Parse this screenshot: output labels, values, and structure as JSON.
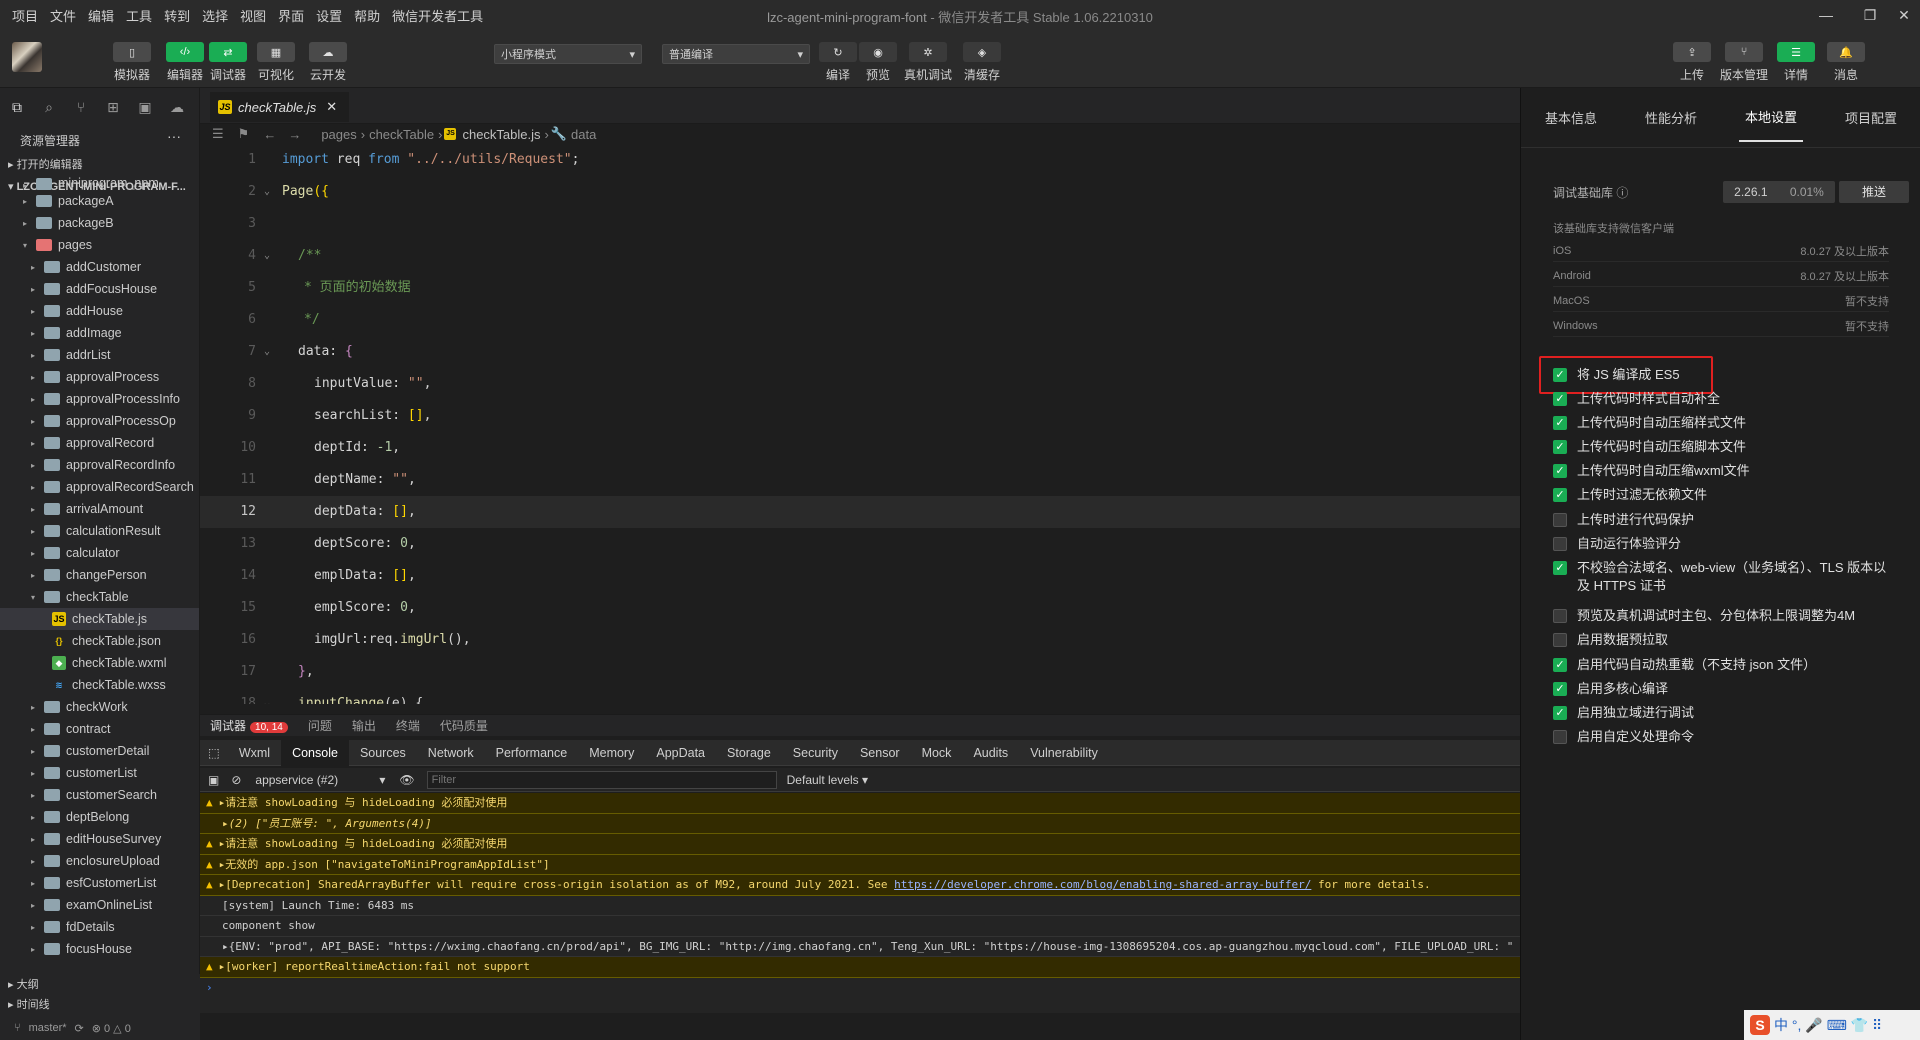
{
  "menu": [
    "项目",
    "文件",
    "编辑",
    "工具",
    "转到",
    "选择",
    "视图",
    "界面",
    "设置",
    "帮助",
    "微信开发者工具"
  ],
  "window_title": {
    "main": "lzc-agent-mini-program-font",
    "sub": "- 微信开发者工具 Stable 1.06.2210310"
  },
  "toolbar": {
    "left_buttons": [
      "模拟器",
      "编辑器",
      "调试器",
      "可视化",
      "云开发"
    ],
    "mode_select": "小程序模式",
    "compile_select": "普通编译",
    "mid_buttons": [
      "编译",
      "预览",
      "真机调试",
      "清缓存"
    ],
    "right_buttons": [
      "上传",
      "版本管理",
      "详情",
      "消息"
    ]
  },
  "explorer": {
    "title": "资源管理器",
    "more": "···",
    "open_editors": "打开的编辑器",
    "project": "LZC-AGENT-MINI-PROGRAM-F...",
    "tree": [
      {
        "label": "miniprogram_npm",
        "type": "folder",
        "depth": 1,
        "arrow": "▸"
      },
      {
        "label": "packageA",
        "type": "folder",
        "depth": 1,
        "arrow": "▸"
      },
      {
        "label": "packageB",
        "type": "folder",
        "depth": 1,
        "arrow": "▸"
      },
      {
        "label": "pages",
        "type": "folder-red",
        "depth": 1,
        "arrow": "▾"
      },
      {
        "label": "addCustomer",
        "type": "folder",
        "depth": 2,
        "arrow": "▸"
      },
      {
        "label": "addFocusHouse",
        "type": "folder",
        "depth": 2,
        "arrow": "▸"
      },
      {
        "label": "addHouse",
        "type": "folder",
        "depth": 2,
        "arrow": "▸"
      },
      {
        "label": "addImage",
        "type": "folder",
        "depth": 2,
        "arrow": "▸"
      },
      {
        "label": "addrList",
        "type": "folder",
        "depth": 2,
        "arrow": "▸"
      },
      {
        "label": "approvalProcess",
        "type": "folder",
        "depth": 2,
        "arrow": "▸"
      },
      {
        "label": "approvalProcessInfo",
        "type": "folder",
        "depth": 2,
        "arrow": "▸"
      },
      {
        "label": "approvalProcessOp",
        "type": "folder",
        "depth": 2,
        "arrow": "▸"
      },
      {
        "label": "approvalRecord",
        "type": "folder",
        "depth": 2,
        "arrow": "▸"
      },
      {
        "label": "approvalRecordInfo",
        "type": "folder",
        "depth": 2,
        "arrow": "▸"
      },
      {
        "label": "approvalRecordSearch",
        "type": "folder",
        "depth": 2,
        "arrow": "▸"
      },
      {
        "label": "arrivalAmount",
        "type": "folder",
        "depth": 2,
        "arrow": "▸"
      },
      {
        "label": "calculationResult",
        "type": "folder",
        "depth": 2,
        "arrow": "▸"
      },
      {
        "label": "calculator",
        "type": "folder",
        "depth": 2,
        "arrow": "▸"
      },
      {
        "label": "changePerson",
        "type": "folder",
        "depth": 2,
        "arrow": "▸"
      },
      {
        "label": "checkTable",
        "type": "folder",
        "depth": 2,
        "arrow": "▾"
      },
      {
        "label": "checkTable.js",
        "type": "js",
        "depth": 3,
        "arrow": ""
      },
      {
        "label": "checkTable.json",
        "type": "json",
        "depth": 3,
        "arrow": ""
      },
      {
        "label": "checkTable.wxml",
        "type": "wxml",
        "depth": 3,
        "arrow": ""
      },
      {
        "label": "checkTable.wxss",
        "type": "wxss",
        "depth": 3,
        "arrow": ""
      },
      {
        "label": "checkWork",
        "type": "folder",
        "depth": 2,
        "arrow": "▸"
      },
      {
        "label": "contract",
        "type": "folder",
        "depth": 2,
        "arrow": "▸"
      },
      {
        "label": "customerDetail",
        "type": "folder",
        "depth": 2,
        "arrow": "▸"
      },
      {
        "label": "customerList",
        "type": "folder",
        "depth": 2,
        "arrow": "▸"
      },
      {
        "label": "customerSearch",
        "type": "folder",
        "depth": 2,
        "arrow": "▸"
      },
      {
        "label": "deptBelong",
        "type": "folder",
        "depth": 2,
        "arrow": "▸"
      },
      {
        "label": "editHouseSurvey",
        "type": "folder",
        "depth": 2,
        "arrow": "▸"
      },
      {
        "label": "enclosureUpload",
        "type": "folder",
        "depth": 2,
        "arrow": "▸"
      },
      {
        "label": "esfCustomerList",
        "type": "folder",
        "depth": 2,
        "arrow": "▸"
      },
      {
        "label": "examOnlineList",
        "type": "folder",
        "depth": 2,
        "arrow": "▸"
      },
      {
        "label": "fdDetails",
        "type": "folder",
        "depth": 2,
        "arrow": "▸"
      },
      {
        "label": "focusHouse",
        "type": "folder",
        "depth": 2,
        "arrow": "▸"
      }
    ],
    "outline": "大纲",
    "timeline": "时间线",
    "branch": "master*",
    "problems": "⊗ 0 △ 0"
  },
  "editor": {
    "tab": "checkTable.js",
    "breadcrumb": [
      "pages",
      "checkTable",
      "checkTable.js",
      "data"
    ],
    "current_line": 12
  },
  "console": {
    "tabs": [
      "调试器",
      "问题",
      "输出",
      "终端",
      "代码质量"
    ],
    "badge": "10, 14",
    "devtools_tabs": [
      "Wxml",
      "Console",
      "Sources",
      "Network",
      "Performance",
      "Memory",
      "AppData",
      "Storage",
      "Security",
      "Sensor",
      "Mock",
      "Audits",
      "Vulnerability"
    ],
    "context": "appservice (#2)",
    "filter_placeholder": "Filter",
    "levels": "Default levels",
    "lines": [
      {
        "kind": "warn",
        "text": "▸请注意 showLoading 与 hideLoading 必须配对使用"
      },
      {
        "kind": "warn-sub",
        "text": "▸(2) [\"员工账号: \", Arguments(4)]"
      },
      {
        "kind": "warn",
        "text": "▸请注意 showLoading 与 hideLoading 必须配对使用"
      },
      {
        "kind": "warn",
        "text": "▸无效的 app.json [\"navigateToMiniProgramAppIdList\"]"
      },
      {
        "kind": "warn",
        "text": "▸[Deprecation] SharedArrayBuffer will require cross-origin isolation as of M92, around July 2021. See ",
        "link": "https://developer.chrome.com/blog/enabling-shared-array-buffer/",
        "tail": " for more details."
      },
      {
        "kind": "log",
        "text": "[system] Launch Time: 6483 ms"
      },
      {
        "kind": "log",
        "text": "component show"
      },
      {
        "kind": "log",
        "text": "▸{ENV: \"prod\", API_BASE: \"https://wximg.chaofang.cn/prod/api\", BG_IMG_URL: \"http://img.chaofang.cn\", Teng_Xun_URL: \"https://house-img-1308695204.cos.ap-guangzhou.myqcloud.com\", FILE_UPLOAD_URL: \""
      },
      {
        "kind": "warn",
        "text": "▸[worker] reportRealtimeAction:fail not support"
      },
      {
        "kind": "prompt",
        "text": "›"
      }
    ]
  },
  "right_panel": {
    "tabs": [
      "基本信息",
      "性能分析",
      "本地设置",
      "项目配置"
    ],
    "lib_label": "调试基础库 ⓘ",
    "lib_version": "2.26.1",
    "lib_percent": "0.01%",
    "push": "推送",
    "support_title": "该基础库支持微信客户端",
    "support": [
      {
        "os": "iOS",
        "value": "8.0.27 及以上版本"
      },
      {
        "os": "Android",
        "value": "8.0.27 及以上版本"
      },
      {
        "os": "MacOS",
        "value": "暂不支持"
      },
      {
        "os": "Windows",
        "value": "暂不支持"
      }
    ],
    "settings": [
      {
        "label": "将 JS 编译成 ES5",
        "checked": true
      },
      {
        "label": "上传代码时样式自动补全",
        "checked": true
      },
      {
        "label": "上传代码时自动压缩样式文件",
        "checked": true
      },
      {
        "label": "上传代码时自动压缩脚本文件",
        "checked": true
      },
      {
        "label": "上传代码时自动压缩wxml文件",
        "checked": true
      },
      {
        "label": "上传时过滤无依赖文件",
        "checked": true
      },
      {
        "label": "上传时进行代码保护",
        "checked": false
      },
      {
        "label": "自动运行体验评分",
        "checked": false
      },
      {
        "label": "不校验合法域名、web-view（业务域名）、TLS 版本以及 HTTPS 证书",
        "checked": true
      },
      {
        "label": "预览及真机调试时主包、分包体积上限调整为4M",
        "checked": false
      },
      {
        "label": "启用数据预拉取",
        "checked": false
      },
      {
        "label": "启用代码自动热重载（不支持 json 文件）",
        "checked": true
      },
      {
        "label": "启用多核心编译",
        "checked": true
      },
      {
        "label": "启用独立域进行调试",
        "checked": true
      },
      {
        "label": "启用自定义处理命令",
        "checked": false
      }
    ]
  },
  "ime": {
    "logo": "S",
    "text": "中 °, 🎤 ⌨ 👕 ⠿"
  }
}
